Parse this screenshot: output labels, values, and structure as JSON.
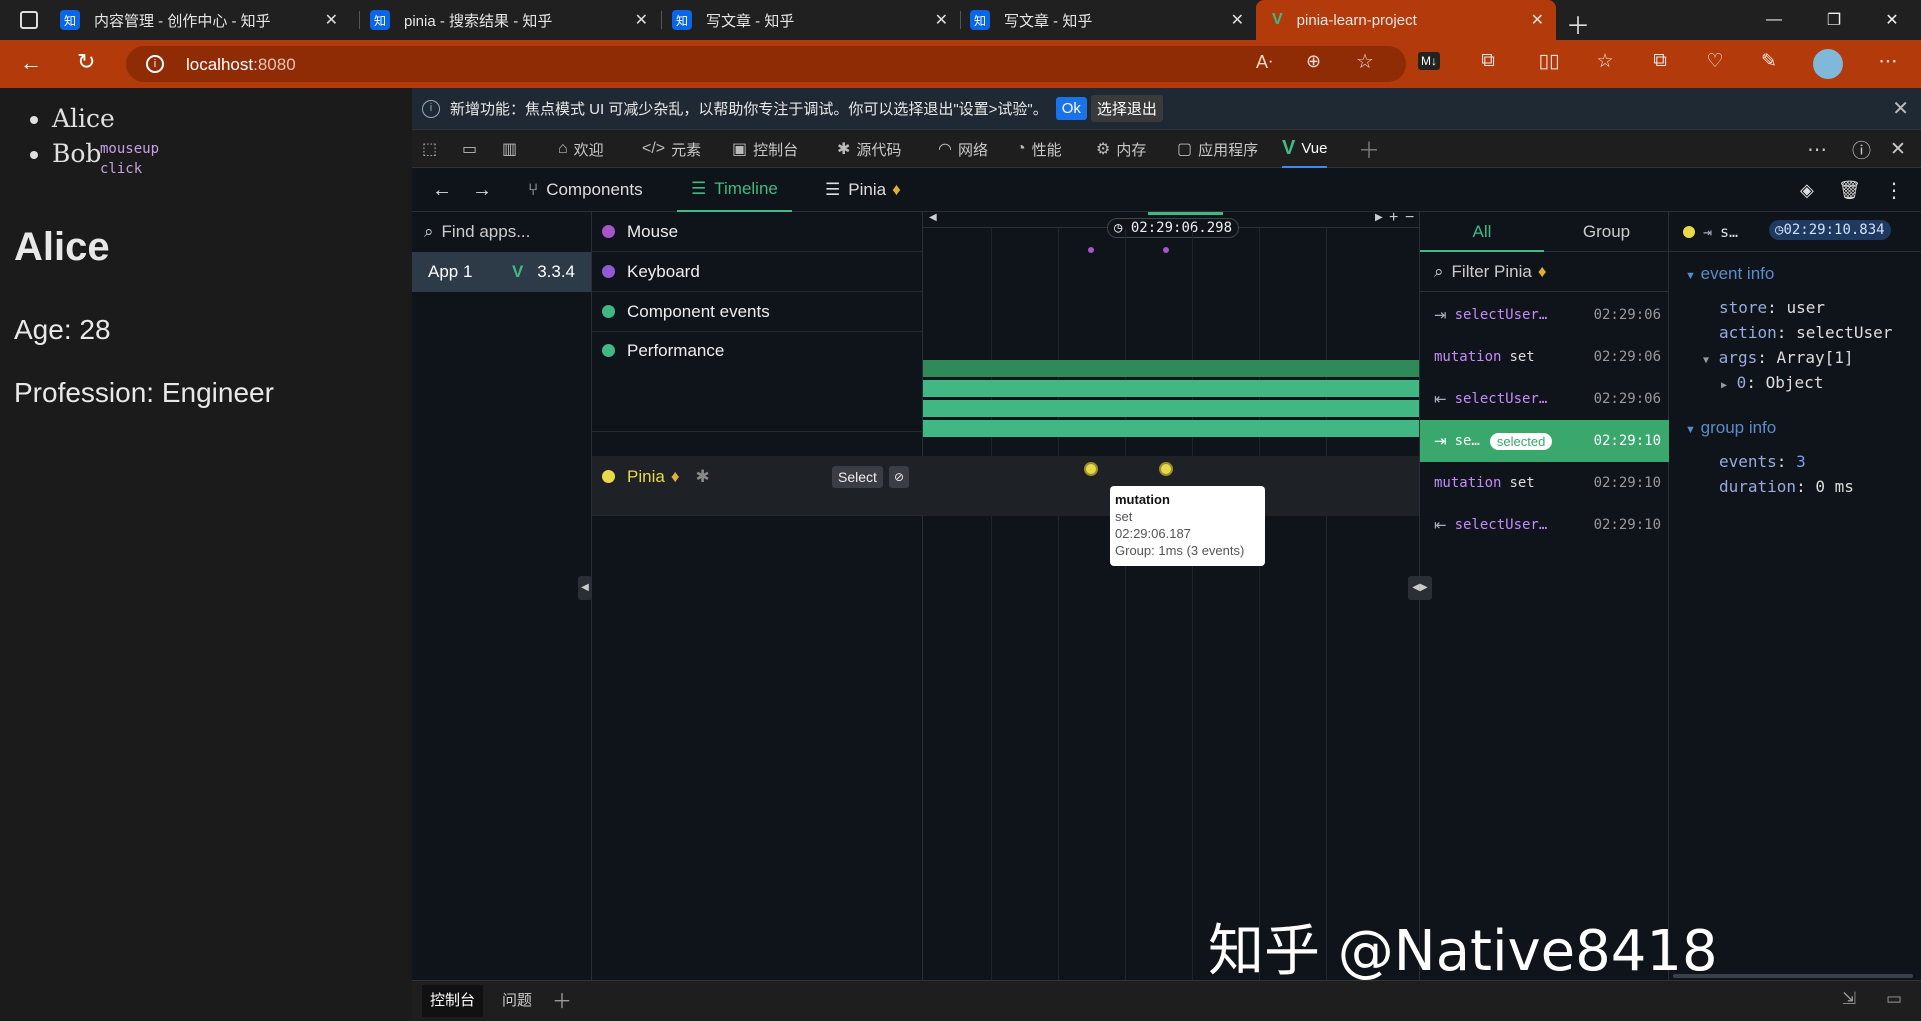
{
  "browser": {
    "tabs": [
      {
        "title": "内容管理 - 创作中心 - 知乎",
        "favicon": "知"
      },
      {
        "title": "pinia - 搜索结果 - 知乎",
        "favicon": "知"
      },
      {
        "title": "写文章 - 知乎",
        "favicon": "知"
      },
      {
        "title": "写文章 - 知乎",
        "favicon": "知"
      },
      {
        "title": "pinia-learn-project",
        "favicon": "V"
      }
    ],
    "url_host": "localhost",
    "url_port": ":8080",
    "accent": "#b23a0b"
  },
  "page": {
    "list": [
      "Alice",
      "Bob"
    ],
    "overlay_mouseup": "mouseup",
    "overlay_click": "click",
    "name": "Alice",
    "age": "Age: 28",
    "profession": "Profession: Engineer"
  },
  "devtools": {
    "infobar": {
      "text": "新增功能：焦点模式 UI 可减少杂乱，以帮助你专注于调试。你可以选择退出\"设置>试验\"。",
      "ok": "Ok",
      "optout": "选择退出"
    },
    "tabs": [
      "欢迎",
      "元素",
      "控制台",
      "源代码",
      "网络",
      "性能",
      "内存",
      "应用程序",
      "Vue"
    ],
    "vue": {
      "tabs": [
        "Components",
        "Timeline",
        "Pinia"
      ],
      "find_apps": "Find apps...",
      "app_name": "App 1",
      "app_version": "3.3.4",
      "layers": [
        {
          "label": "Mouse",
          "color": "#a855c7"
        },
        {
          "label": "Keyboard",
          "color": "#8e5ad6"
        },
        {
          "label": "Component events",
          "color": "#41b883"
        },
        {
          "label": "Performance",
          "color": "#41b883"
        },
        {
          "label": "Pinia",
          "color": "#e9d94a"
        }
      ],
      "select_label": "Select",
      "cursor_time": "02:29:06.298",
      "tooltip": {
        "title": "mutation",
        "sub": "set",
        "time": "02:29:06.187",
        "group": "Group: 1ms (3 events)"
      },
      "event_tabs": [
        "All",
        "Group"
      ],
      "filter": "Filter Pinia",
      "events": [
        {
          "kind": "action",
          "label": "selectUser…",
          "time": "02:29:06"
        },
        {
          "kind": "mutation",
          "label": "set",
          "time": "02:29:06"
        },
        {
          "kind": "action-end",
          "label": "selectUser…",
          "time": "02:29:06"
        },
        {
          "kind": "action",
          "label": "se…",
          "badge": "selected",
          "time": "02:29:10"
        },
        {
          "kind": "mutation",
          "label": "set",
          "time": "02:29:10"
        },
        {
          "kind": "action-end",
          "label": "selectUser…",
          "time": "02:29:10"
        }
      ],
      "detail": {
        "header_label": "s…",
        "header_time": "02:29:10.834",
        "event_info": "event info",
        "store_key": "store",
        "store_val": "user",
        "action_key": "action",
        "action_val": "selectUser",
        "args_key": "args",
        "args_val": "Array[1]",
        "arg0_key": "0",
        "arg0_val": "Object",
        "group_info": "group info",
        "events_key": "events",
        "events_val": "3",
        "duration_key": "duration",
        "duration_val": "0 ms"
      }
    },
    "bottom_tabs": [
      "控制台",
      "问题"
    ],
    "watermark": "知乎 @Native8418"
  }
}
